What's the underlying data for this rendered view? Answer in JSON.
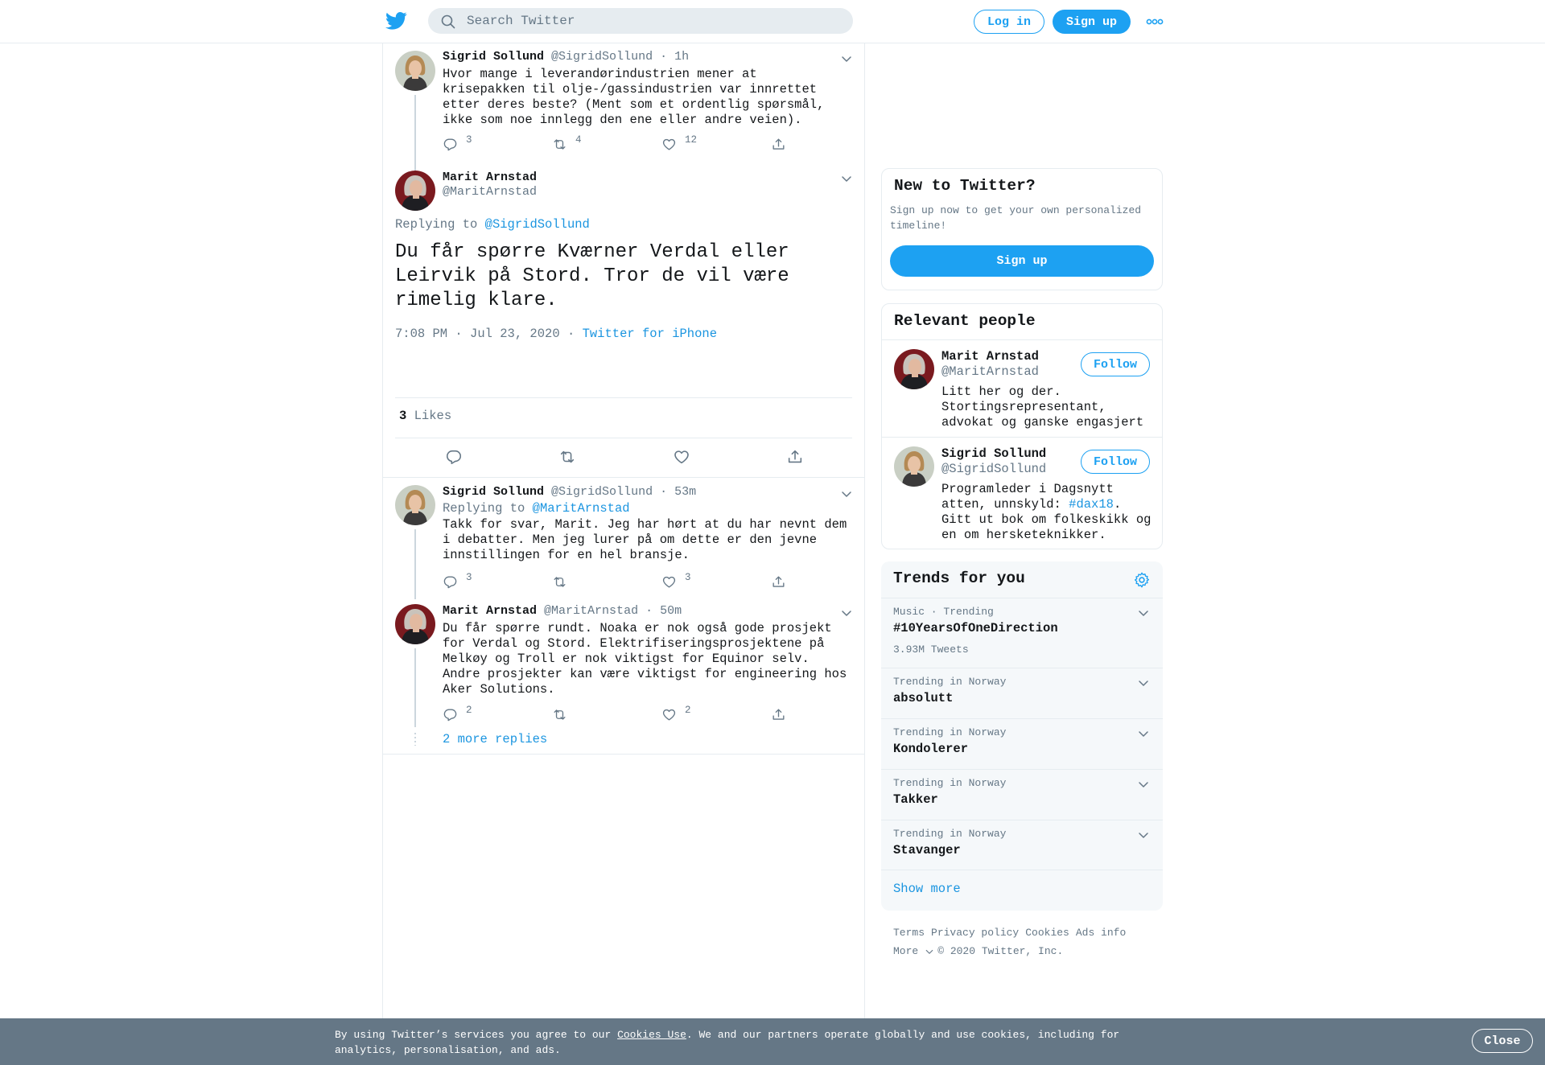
{
  "topbar": {
    "search_placeholder": "Search Twitter",
    "login_label": "Log in",
    "signup_label": "Sign up",
    "more_icon": "more-dots-icon",
    "logo_icon": "twitter-bird-icon"
  },
  "thread": {
    "tweet1": {
      "name": "Sigrid Sollund",
      "handle": "@SigridSollund",
      "time": "1h",
      "text": "Hvor mange i leverandørindustrien mener at krisepakken til olje-/gassindustrien var innrettet etter deres beste? (Ment som et ordentlig spørsmål, ikke som noe innlegg den ene eller andre veien).",
      "replies": "3",
      "retweets": "4",
      "likes": "12"
    },
    "focused": {
      "name": "Marit Arnstad",
      "handle": "@MaritArnstad",
      "replying_label": "Replying to",
      "replying_to": "@SigridSollund",
      "text": "Du får spørre Kværner Verdal eller Leirvik på Stord. Tror de vil være rimelig klare.",
      "timestamp": "7:08 PM · Jul 23, 2020",
      "separator": "·",
      "source": "Twitter for iPhone",
      "likes_count": "3",
      "likes_label": "Likes"
    },
    "reply1": {
      "name": "Sigrid Sollund",
      "handle": "@SigridSollund",
      "time": "53m",
      "replying_label": "Replying to",
      "replying_to": "@MaritArnstad",
      "text": "Takk for svar, Marit. Jeg har hørt at du har nevnt dem i debatter. Men jeg lurer på om dette er den jevne innstillingen for en hel bransje.",
      "replies": "3",
      "retweets": "",
      "likes": "3"
    },
    "reply2": {
      "name": "Marit Arnstad",
      "handle": "@MaritArnstad",
      "time": "50m",
      "text": "Du får spørre rundt. Noaka er nok også gode prosjekt for Verdal og Stord. Elektrifiseringsprosjektene på Melkøy og Troll er nok viktigst for Equinor selv. Andre prosjekter kan være viktigst for engineering hos Aker Solutions.",
      "replies": "2",
      "retweets": "",
      "likes": "2"
    },
    "more_replies": "2 more replies"
  },
  "sidebar": {
    "new_to_twitter": {
      "title": "New to Twitter?",
      "subtitle": "Sign up now to get your own personalized timeline!",
      "button": "Sign up"
    },
    "relevant_people": {
      "title": "Relevant people",
      "people": [
        {
          "name": "Marit Arnstad",
          "handle": "@MaritArnstad",
          "follow": "Follow",
          "bio": "Litt her og der. Stortingsrepresentant, advokat og ganske engasjert"
        },
        {
          "name": "Sigrid Sollund",
          "handle": "@SigridSollund",
          "follow": "Follow",
          "bio_before": "Programleder i Dagsnytt atten, unnskyld: ",
          "bio_link": "#dax18",
          "bio_after": ". Gitt ut bok om folkeskikk og en om hersketeknikker."
        }
      ]
    },
    "trends": {
      "title": "Trends for you",
      "items": [
        {
          "context": "Music · Trending",
          "name": "#10YearsOfOneDirection",
          "count": "3.93M Tweets"
        },
        {
          "context": "Trending in Norway",
          "name": "absolutt"
        },
        {
          "context": "Trending in Norway",
          "name": "Kondolerer"
        },
        {
          "context": "Trending in Norway",
          "name": "Takker"
        },
        {
          "context": "Trending in Norway",
          "name": "Stavanger"
        }
      ],
      "show_more": "Show more"
    },
    "footer": {
      "links": [
        "Terms",
        "Privacy policy",
        "Cookies",
        "Ads info"
      ],
      "more": "More",
      "copyright": "© 2020 Twitter, Inc."
    }
  },
  "cookie_bar": {
    "text_before": "By using Twitter’s services you agree to our ",
    "link": "Cookies Use",
    "text_after": ". We and our partners operate globally and use cookies, including for analytics, personalisation, and ads.",
    "close": "Close"
  },
  "colors": {
    "accent": "#1da1f2",
    "link": "#1b95e0",
    "secondary_text": "#657786",
    "border": "#e6ecf0",
    "cookie_bg": "#657786"
  }
}
